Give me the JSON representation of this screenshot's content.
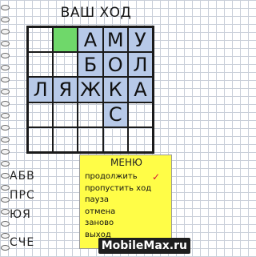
{
  "header": {
    "title": "ВАШ ХОД"
  },
  "board": {
    "rows": [
      [
        "",
        "",
        "",
        "",
        ""
      ],
      [
        "",
        "",
        "",
        "",
        ""
      ],
      [
        "",
        "",
        "",
        "",
        ""
      ],
      [
        "",
        "",
        "",
        "",
        ""
      ],
      [
        "",
        "",
        "",
        "",
        ""
      ]
    ],
    "cells": [
      [
        {
          "l": "",
          "s": "empty"
        },
        {
          "l": "",
          "s": "cursor"
        },
        {
          "l": "А",
          "s": "filled"
        },
        {
          "l": "М",
          "s": "filled"
        },
        {
          "l": "У",
          "s": "filled"
        }
      ],
      [
        {
          "l": "",
          "s": "empty"
        },
        {
          "l": "",
          "s": "empty"
        },
        {
          "l": "Б",
          "s": "filled"
        },
        {
          "l": "О",
          "s": "filled"
        },
        {
          "l": "Л",
          "s": "filled"
        }
      ],
      [
        {
          "l": "Л",
          "s": "filled"
        },
        {
          "l": "Я",
          "s": "filled"
        },
        {
          "l": "Ж",
          "s": "filled"
        },
        {
          "l": "К",
          "s": "filled"
        },
        {
          "l": "А",
          "s": "filled"
        }
      ],
      [
        {
          "l": "",
          "s": "empty"
        },
        {
          "l": "",
          "s": "empty"
        },
        {
          "l": "",
          "s": "empty"
        },
        {
          "l": "С",
          "s": "filled"
        },
        {
          "l": "",
          "s": "empty"
        }
      ],
      [
        {
          "l": "",
          "s": "empty"
        },
        {
          "l": "",
          "s": "empty"
        },
        {
          "l": "",
          "s": "empty"
        },
        {
          "l": "",
          "s": "empty"
        },
        {
          "l": "",
          "s": "empty"
        }
      ]
    ]
  },
  "side_text": [
    "АБВ",
    "ПРС",
    "ЮЯ",
    "СЧЕ"
  ],
  "menu": {
    "title": "МЕНЮ",
    "items": [
      "продолжить",
      "пропустить ход",
      "пауза",
      "отмена",
      "заново",
      "выход"
    ],
    "selected": "продолжить"
  },
  "watermark": "MobileMax.ru",
  "colors": {
    "filled_cell": "#b7c9e8",
    "cursor_cell": "#6fd86a",
    "menu_bg": "#fffd47",
    "check": "#d4143a"
  }
}
